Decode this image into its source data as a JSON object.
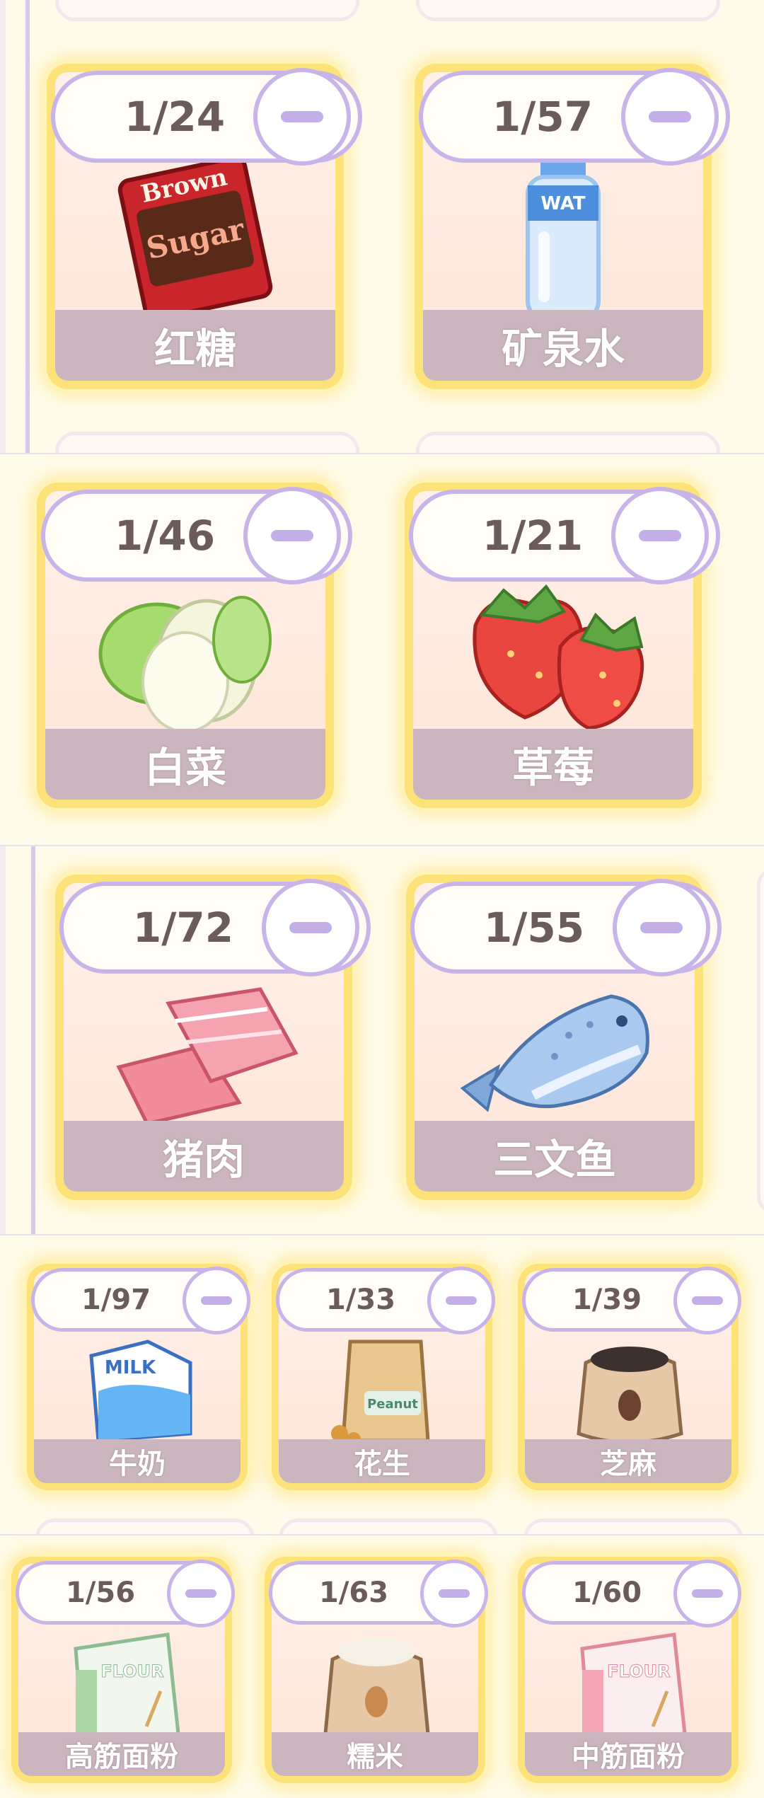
{
  "colors": {
    "card_glow": "#fde27a",
    "pill_border": "#c9b4ea",
    "name_band": "#cbb6bf",
    "count_text": "#6c5c58",
    "page_bg": "#fffbea"
  },
  "items": [
    {
      "count": "1/24",
      "name": "红糖",
      "icon": "brown-sugar-icon"
    },
    {
      "count": "1/57",
      "name": "矿泉水",
      "icon": "mineral-water-icon"
    },
    {
      "count": "1/46",
      "name": "白菜",
      "icon": "cabbage-icon"
    },
    {
      "count": "1/21",
      "name": "草莓",
      "icon": "strawberry-icon"
    },
    {
      "count": "1/72",
      "name": "猪肉",
      "icon": "pork-icon"
    },
    {
      "count": "1/55",
      "name": "三文鱼",
      "icon": "salmon-icon"
    },
    {
      "count": "1/97",
      "name": "牛奶",
      "icon": "milk-icon"
    },
    {
      "count": "1/33",
      "name": "花生",
      "icon": "peanut-icon"
    },
    {
      "count": "1/39",
      "name": "芝麻",
      "icon": "sesame-icon"
    },
    {
      "count": "1/56",
      "name": "高筋面粉",
      "icon": "bread-flour-icon"
    },
    {
      "count": "1/63",
      "name": "糯米",
      "icon": "glutinous-rice-icon"
    },
    {
      "count": "1/60",
      "name": "中筋面粉",
      "icon": "all-purpose-flour-icon"
    }
  ]
}
